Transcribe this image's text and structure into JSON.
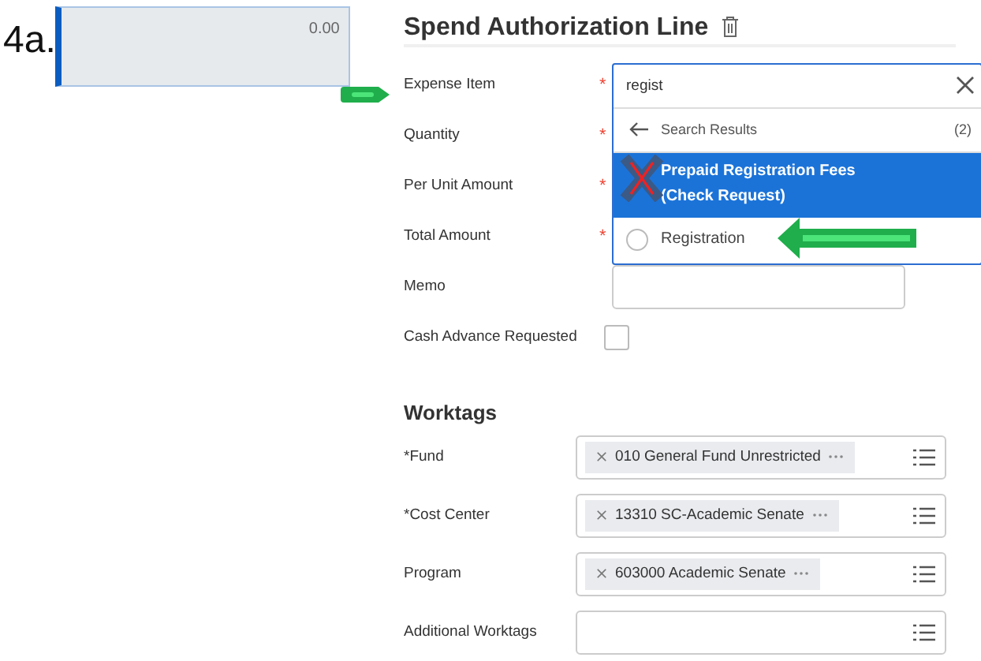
{
  "step_label": "4a.",
  "amount_box": {
    "value": "0.00"
  },
  "section": {
    "title": "Spend Authorization Line"
  },
  "fields": [
    {
      "label": "Expense Item",
      "mark": "*",
      "kind": "search",
      "search": {
        "value": "regist",
        "header": "Search Results",
        "count": "(2)",
        "results": [
          {
            "lines": [
              "Prepaid Registration Fees",
              "(Check Request)"
            ],
            "selected": true
          },
          {
            "lines": [
              "Registration"
            ],
            "selected": false
          }
        ]
      }
    },
    {
      "label": "Quantity",
      "mark": "*"
    },
    {
      "label": "Per Unit Amount",
      "mark": "*"
    },
    {
      "label": "Total Amount",
      "mark": "*"
    },
    {
      "label": "Memo",
      "kind": "text"
    },
    {
      "label": "Cash Advance Requested",
      "kind": "checkbox",
      "checked": false
    }
  ],
  "worktags": {
    "title": "Worktags",
    "rows": [
      {
        "label": "*Fund",
        "tags": [
          "010 General Fund Unrestricted"
        ]
      },
      {
        "label": "*Cost Center",
        "tags": [
          "13310 SC-Academic Senate"
        ]
      },
      {
        "label": "Program",
        "tags": [
          "603000 Academic Senate"
        ]
      },
      {
        "label": "Additional Worktags"
      }
    ]
  }
}
